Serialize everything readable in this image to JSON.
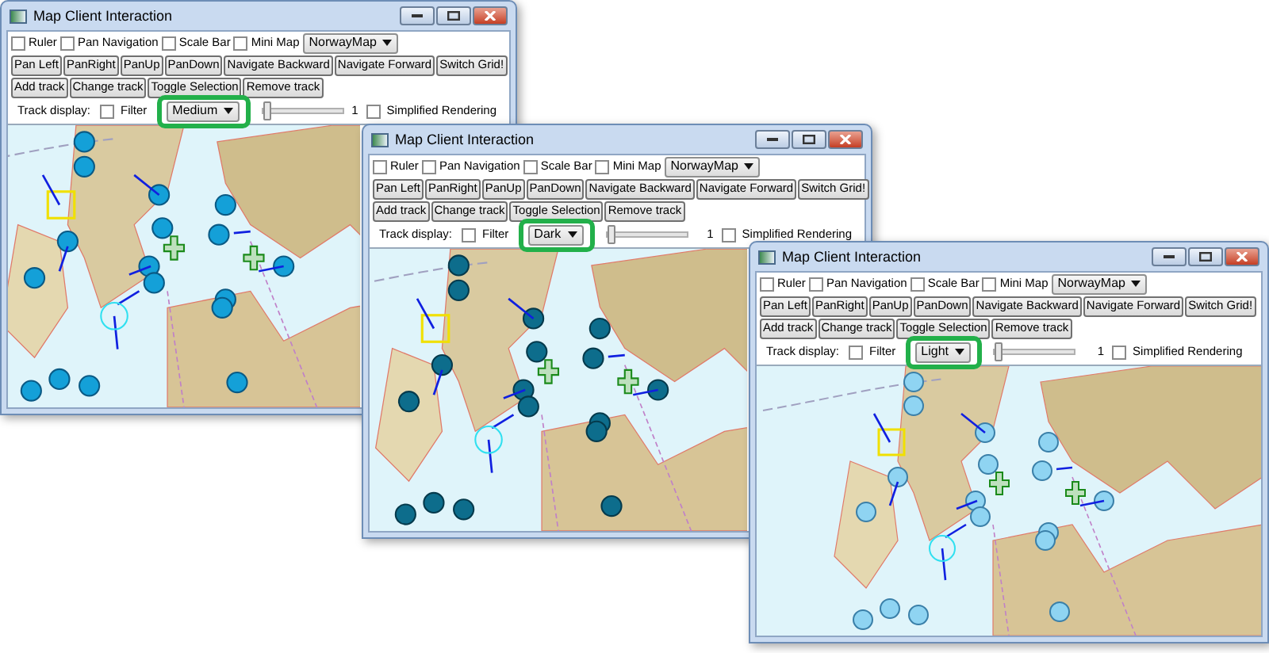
{
  "windows": [
    {
      "title": "Map Client Interaction",
      "kind": "medium",
      "highlighted": true,
      "options": [
        {
          "label": "Ruler",
          "checked": false
        },
        {
          "label": "Pan Navigation",
          "checked": false
        },
        {
          "label": "Scale Bar",
          "checked": false
        },
        {
          "label": "Mini Map",
          "checked": false
        }
      ],
      "map_select": "NorwayMap",
      "button_rows": [
        [
          "Pan Left",
          "PanRight",
          "PanUp",
          "PanDown",
          "Navigate Backward",
          "Navigate Forward",
          "Switch Grid!"
        ],
        [
          "Add track",
          "Change track",
          "Toggle Selection",
          "Remove track"
        ]
      ],
      "track_label": "Track display:",
      "filter": {
        "label": "Filter",
        "checked": false
      },
      "style_select": "Medium",
      "slider": {
        "level": 0,
        "reading": "1"
      },
      "simplified": {
        "label": "Simplified Rendering",
        "checked": false
      }
    },
    {
      "title": "Map Client Interaction",
      "kind": "dark",
      "highlighted": true,
      "options": [
        {
          "label": "Ruler",
          "checked": false
        },
        {
          "label": "Pan Navigation",
          "checked": false
        },
        {
          "label": "Scale Bar",
          "checked": false
        },
        {
          "label": "Mini Map",
          "checked": false
        }
      ],
      "map_select": "NorwayMap",
      "button_rows": [
        [
          "Pan Left",
          "PanRight",
          "PanUp",
          "PanDown",
          "Navigate Backward",
          "Navigate Forward",
          "Switch Grid!"
        ],
        [
          "Add track",
          "Change track",
          "Toggle Selection",
          "Remove track"
        ]
      ],
      "track_label": "Track display:",
      "filter": {
        "label": "Filter",
        "checked": false
      },
      "style_select": "Dark",
      "slider": {
        "level": 0,
        "reading": "1"
      },
      "simplified": {
        "label": "Simplified Rendering",
        "checked": false
      }
    },
    {
      "title": "Map Client Interaction",
      "kind": "light",
      "highlighted": true,
      "options": [
        {
          "label": "Ruler",
          "checked": false
        },
        {
          "label": "Pan Navigation",
          "checked": false
        },
        {
          "label": "Scale Bar",
          "checked": false
        },
        {
          "label": "Mini Map",
          "checked": false
        }
      ],
      "map_select": "NorwayMap",
      "button_rows": [
        [
          "Pan Left",
          "PanRight",
          "PanUp",
          "PanDown",
          "Navigate Backward",
          "Navigate Forward",
          "Switch Grid!"
        ],
        [
          "Add track",
          "Change track",
          "Toggle Selection",
          "Remove track"
        ]
      ],
      "track_label": "Track display:",
      "filter": {
        "label": "Filter",
        "checked": false
      },
      "style_select": "Light",
      "slider": {
        "level": 0,
        "reading": "1"
      },
      "simplified": {
        "label": "Simplified Rendering",
        "checked": false
      }
    }
  ]
}
